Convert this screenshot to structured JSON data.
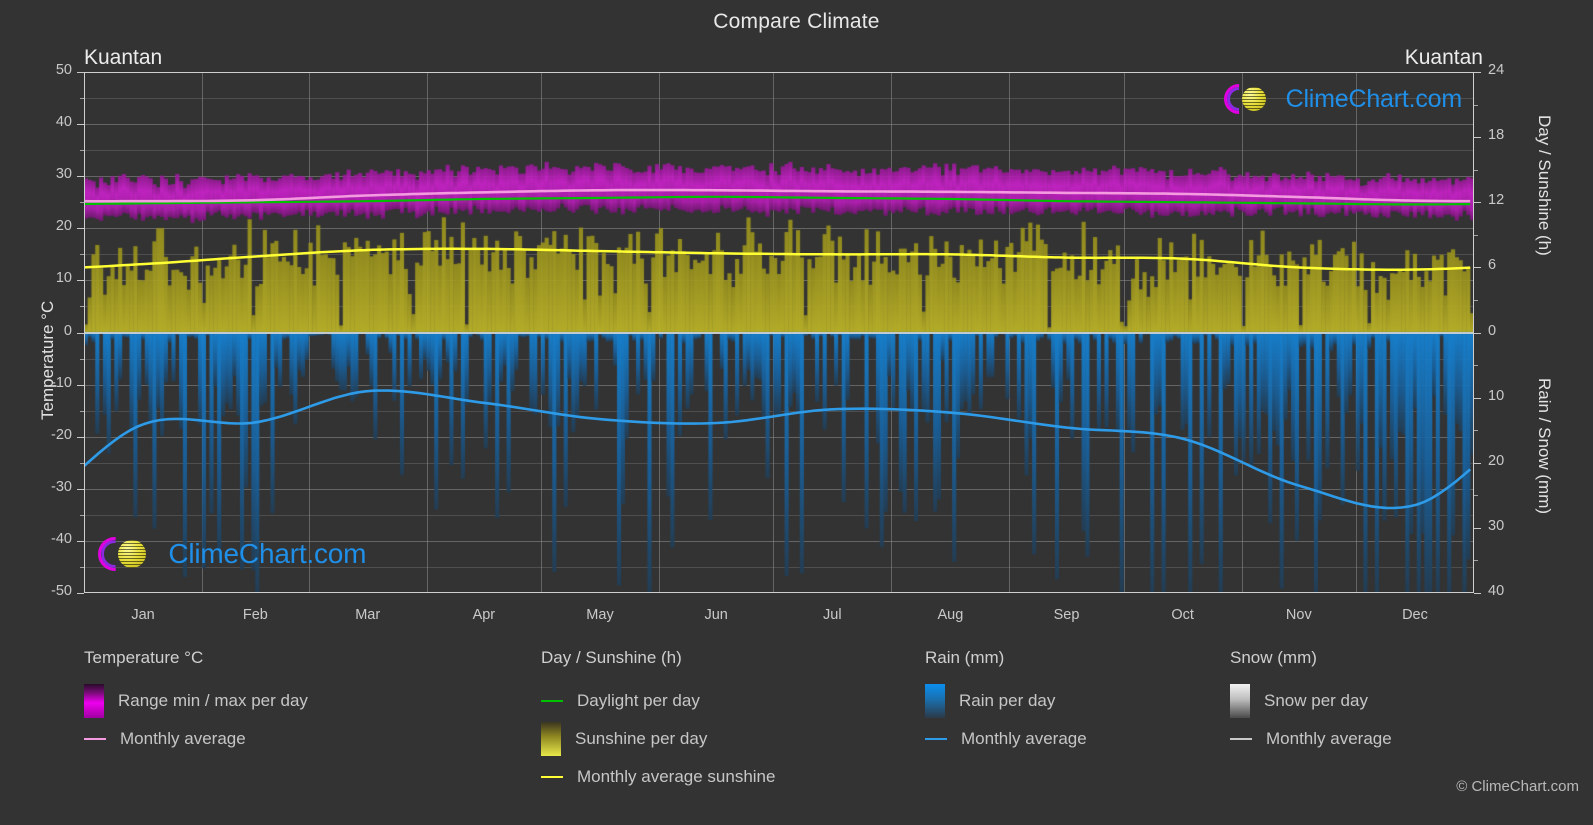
{
  "header": {
    "title": "Compare Climate",
    "location_left": "Kuantan",
    "location_right": "Kuantan"
  },
  "axes": {
    "left_title": "Temperature °C",
    "left_ticks": [
      "50",
      "40",
      "30",
      "20",
      "10",
      "0",
      "-10",
      "-20",
      "-30",
      "-40",
      "-50"
    ],
    "right_top_title": "Day / Sunshine (h)",
    "right_top_ticks": [
      "24",
      "18",
      "12",
      "6",
      "0"
    ],
    "right_bottom_title": "Rain / Snow (mm)",
    "right_bottom_ticks": [
      "0",
      "10",
      "20",
      "30",
      "40"
    ],
    "x_ticks": [
      "Jan",
      "Feb",
      "Mar",
      "Apr",
      "May",
      "Jun",
      "Jul",
      "Aug",
      "Sep",
      "Oct",
      "Nov",
      "Dec"
    ]
  },
  "legend": {
    "columns": [
      {
        "heading": "Temperature °C",
        "items": [
          {
            "label": "Range min / max per day",
            "marker": "swatch",
            "color": "#e000e0"
          },
          {
            "label": "Monthly average",
            "marker": "line",
            "color": "#f49ae0"
          }
        ]
      },
      {
        "heading": "Day / Sunshine (h)",
        "items": [
          {
            "label": "Daylight per day",
            "marker": "line",
            "color": "#00c000"
          },
          {
            "label": "Sunshine per day",
            "marker": "swatch",
            "color": "#e8e83c"
          },
          {
            "label": "Monthly average sunshine",
            "marker": "line",
            "color": "#ffff33"
          }
        ]
      },
      {
        "heading": "Rain (mm)",
        "items": [
          {
            "label": "Rain per day",
            "marker": "swatch",
            "color": "#0582e0"
          },
          {
            "label": "Monthly average",
            "marker": "line",
            "color": "#2e9be8"
          }
        ]
      },
      {
        "heading": "Snow (mm)",
        "items": [
          {
            "label": "Snow per day",
            "marker": "swatch",
            "color": "#ededed"
          },
          {
            "label": "Monthly average",
            "marker": "line",
            "color": "#c9c9c9"
          }
        ]
      }
    ],
    "copyright": "© ClimeChart.com"
  },
  "watermark": {
    "text": "ClimeChart.com"
  },
  "colors": {
    "background": "#333333",
    "grid": "#8e8e8e",
    "temperature_range": "#c420c4",
    "temperature_avg": "#f49ae0",
    "daylight": "#00c000",
    "sunshine": "#b5ad22",
    "sunshine_avg": "#ffff33",
    "rain": "#1f6fa8",
    "rain_avg": "#2e9be8",
    "text": "#c9c9c9"
  },
  "chart_data": {
    "type": "area",
    "title": "Compare Climate",
    "subtitle": "Kuantan",
    "xlabel": "",
    "ylabel": "Temperature °C",
    "ylim": [
      -50,
      50
    ],
    "y2_top_label": "Day / Sunshine (h)",
    "y2_top_lim": [
      0,
      24
    ],
    "y2_bottom_label": "Rain / Snow (mm)",
    "y2_bottom_lim": [
      0,
      40
    ],
    "grid": true,
    "legend_position": "bottom",
    "categories": [
      "Jan",
      "Feb",
      "Mar",
      "Apr",
      "May",
      "Jun",
      "Jul",
      "Aug",
      "Sep",
      "Oct",
      "Nov",
      "Dec"
    ],
    "series": [
      {
        "name": "Temperature monthly average (°C)",
        "unit": "°C",
        "values": [
          25.2,
          25.4,
          26.3,
          26.9,
          27.3,
          27.3,
          27.1,
          27.0,
          26.8,
          26.6,
          26.0,
          25.3
        ]
      },
      {
        "name": "Temperature daily max (°C)",
        "unit": "°C",
        "values": [
          29.0,
          29.5,
          30.5,
          31.3,
          31.6,
          31.5,
          31.3,
          31.2,
          31.0,
          30.8,
          30.0,
          29.2
        ]
      },
      {
        "name": "Temperature daily min (°C)",
        "unit": "°C",
        "values": [
          22.3,
          22.4,
          22.9,
          23.3,
          23.6,
          23.4,
          23.2,
          23.2,
          23.1,
          23.0,
          23.0,
          22.6
        ]
      },
      {
        "name": "Daylight per day (h)",
        "unit": "h",
        "values": [
          11.9,
          12.0,
          12.1,
          12.3,
          12.4,
          12.5,
          12.4,
          12.3,
          12.1,
          12.0,
          11.9,
          11.8
        ]
      },
      {
        "name": "Monthly average sunshine (h)",
        "unit": "h",
        "values": [
          6.3,
          7.0,
          7.6,
          7.7,
          7.5,
          7.3,
          7.2,
          7.2,
          6.9,
          6.8,
          6.0,
          5.8
        ]
      },
      {
        "name": "Rain monthly average (mm)",
        "unit": "mm",
        "values": [
          14.1,
          13.8,
          9.0,
          10.8,
          13.3,
          13.9,
          11.8,
          12.3,
          14.6,
          16.3,
          23.5,
          26.5
        ]
      }
    ],
    "notes": "Daily values drawn as dense vertical bars: magenta = daily temperature min/max range, olive/yellow = daily sunshine hours (0 at the 0 line growing upward on the right-hand Day/Sunshine scale), blue = daily rain drawn downward from the 0 line on the Rain/Snow scale. Smooth overlaid curves are the monthly averages."
  }
}
